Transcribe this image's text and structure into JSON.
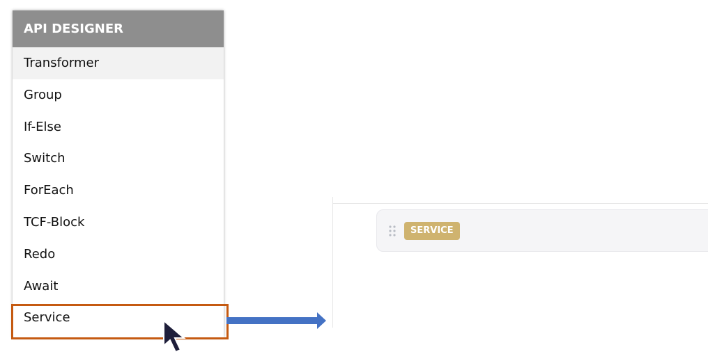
{
  "menu": {
    "title": "API DESIGNER",
    "items": [
      {
        "label": "Transformer"
      },
      {
        "label": "Group"
      },
      {
        "label": "If-Else"
      },
      {
        "label": "Switch"
      },
      {
        "label": "ForEach"
      },
      {
        "label": "TCF-Block"
      },
      {
        "label": "Redo"
      },
      {
        "label": "Await"
      },
      {
        "label": "Service"
      }
    ],
    "hovered_item": "Transformer",
    "selected_item": "Service"
  },
  "canvas": {
    "block_badge": "SERVICE"
  },
  "colors": {
    "highlight": "#c55a11",
    "arrow": "#4472c4",
    "badge": "#cfb36f",
    "header": "#8e8e8e"
  }
}
